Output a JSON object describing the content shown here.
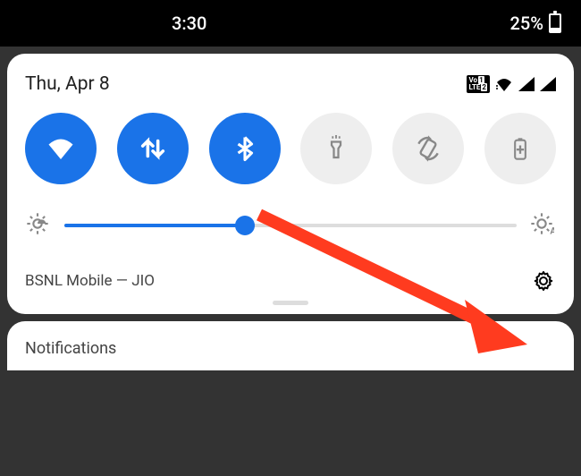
{
  "status_bar": {
    "time": "3:30",
    "battery_pct": "25%"
  },
  "panel": {
    "date": "Thu, Apr 8",
    "carrier": "BSNL Mobile — JIO",
    "brightness_value": 40,
    "toggles": {
      "wifi_active": true,
      "data_active": true,
      "bluetooth_active": true,
      "flashlight_active": false,
      "autorotate_active": false,
      "battery_saver_active": false
    }
  },
  "notifications": {
    "title": "Notifications"
  },
  "colors": {
    "accent": "#1a73e8",
    "annotation": "#ff3b1f"
  }
}
